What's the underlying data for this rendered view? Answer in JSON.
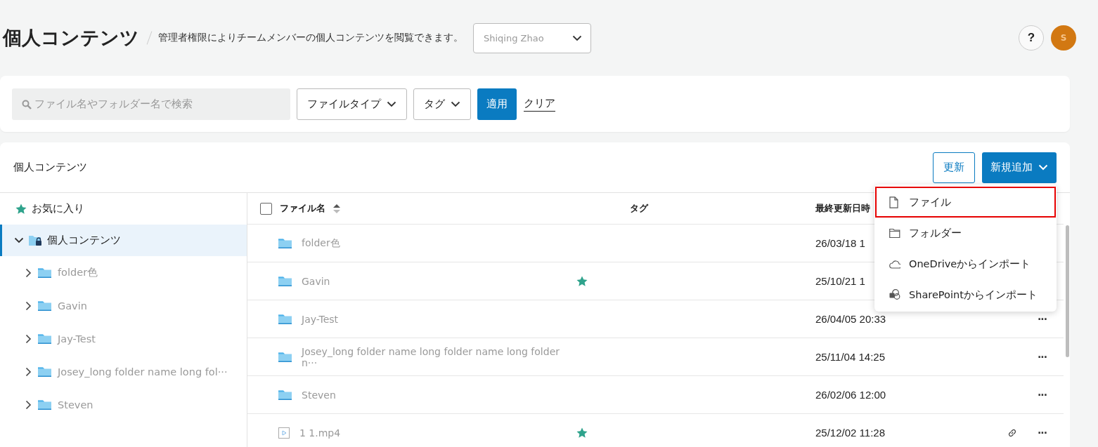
{
  "header": {
    "title": "個人コンテンツ",
    "description": "管理者権限によりチームメンバーの個人コンテンツを閲覧できます。",
    "member_select": {
      "value": "Shiqing Zhao"
    },
    "help": "?",
    "avatar": "S"
  },
  "filters": {
    "search": {
      "placeholder": "ファイル名やフォルダー名で検索"
    },
    "file_type": "ファイルタイプ",
    "tag": "タグ",
    "apply": "適用",
    "clear": "クリア"
  },
  "panel": {
    "title": "個人コンテンツ",
    "refresh": "更新",
    "add_new": "新規追加"
  },
  "sidebar": {
    "items": [
      {
        "kind": "favorites",
        "label": "お気に入り",
        "selected": false
      },
      {
        "kind": "personal",
        "label": "個人コンテンツ",
        "selected": true,
        "expanded": true,
        "children": [
          {
            "label": "folder色",
            "expanded": false
          },
          {
            "label": "Gavin",
            "expanded": false
          },
          {
            "label": "Jay-Test",
            "expanded": false
          },
          {
            "label": "Josey_long folder name long fol···",
            "expanded": false
          },
          {
            "label": "Steven",
            "expanded": false
          }
        ]
      }
    ]
  },
  "table": {
    "select_all": {
      "checked": false
    },
    "columns": [
      {
        "label": "ファイル名",
        "sortable": true
      },
      {
        "label": "タグ",
        "sortable": false
      },
      {
        "label": "最終更新日時",
        "sortable": false
      }
    ],
    "rows": [
      {
        "kind": "folder",
        "name": "folder色",
        "favorite": false,
        "modified": "26/03/18 1",
        "link": false
      },
      {
        "kind": "folder",
        "name": "Gavin",
        "favorite": true,
        "modified": "25/10/21 1",
        "link": false
      },
      {
        "kind": "folder",
        "name": "Jay-Test",
        "favorite": false,
        "modified": "26/04/05 20:33",
        "link": false,
        "more": "···"
      },
      {
        "kind": "folder",
        "name": "Josey_long folder name long folder name long folder n···",
        "favorite": false,
        "modified": "25/11/04 14:25",
        "link": false,
        "more": "···"
      },
      {
        "kind": "folder",
        "name": "Steven",
        "favorite": false,
        "modified": "26/02/06 12:00",
        "link": false,
        "more": "···"
      },
      {
        "kind": "video",
        "name": "1 1.mp4",
        "favorite": true,
        "modified": "25/12/02 11:28",
        "link": true,
        "more": "···"
      }
    ]
  },
  "menu": {
    "items": [
      {
        "kind": "file",
        "label": "ファイル",
        "highlighted": true
      },
      {
        "kind": "folder",
        "label": "フォルダー",
        "highlighted": false
      },
      {
        "kind": "onedrive",
        "label": "OneDriveからインポート",
        "highlighted": false
      },
      {
        "kind": "sharepoint",
        "label": "SharePointからインポート",
        "highlighted": false
      }
    ]
  }
}
